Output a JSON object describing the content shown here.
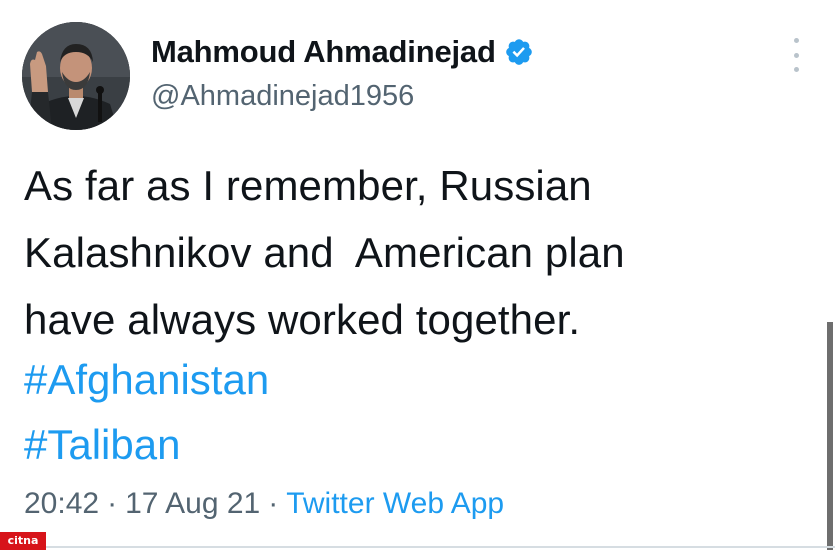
{
  "tweet": {
    "display_name": "Mahmoud Ahmadinejad",
    "handle": "@Ahmadinejad1956",
    "body_lines": [
      "As far as I remember, Russian",
      "Kalashnikov and  American plan",
      "have always worked together."
    ],
    "hashtags": [
      "#Afghanistan",
      "#Taliban"
    ],
    "time": "20:42",
    "date": "17 Aug 21",
    "separator": "·",
    "source": "Twitter Web App"
  },
  "watermark": "citna",
  "icons": {
    "verified": "verified-badge-icon",
    "more": "more-options-icon"
  },
  "colors": {
    "link": "#1d9bf0",
    "secondary_text": "#536471",
    "primary_text": "#0f1419"
  }
}
